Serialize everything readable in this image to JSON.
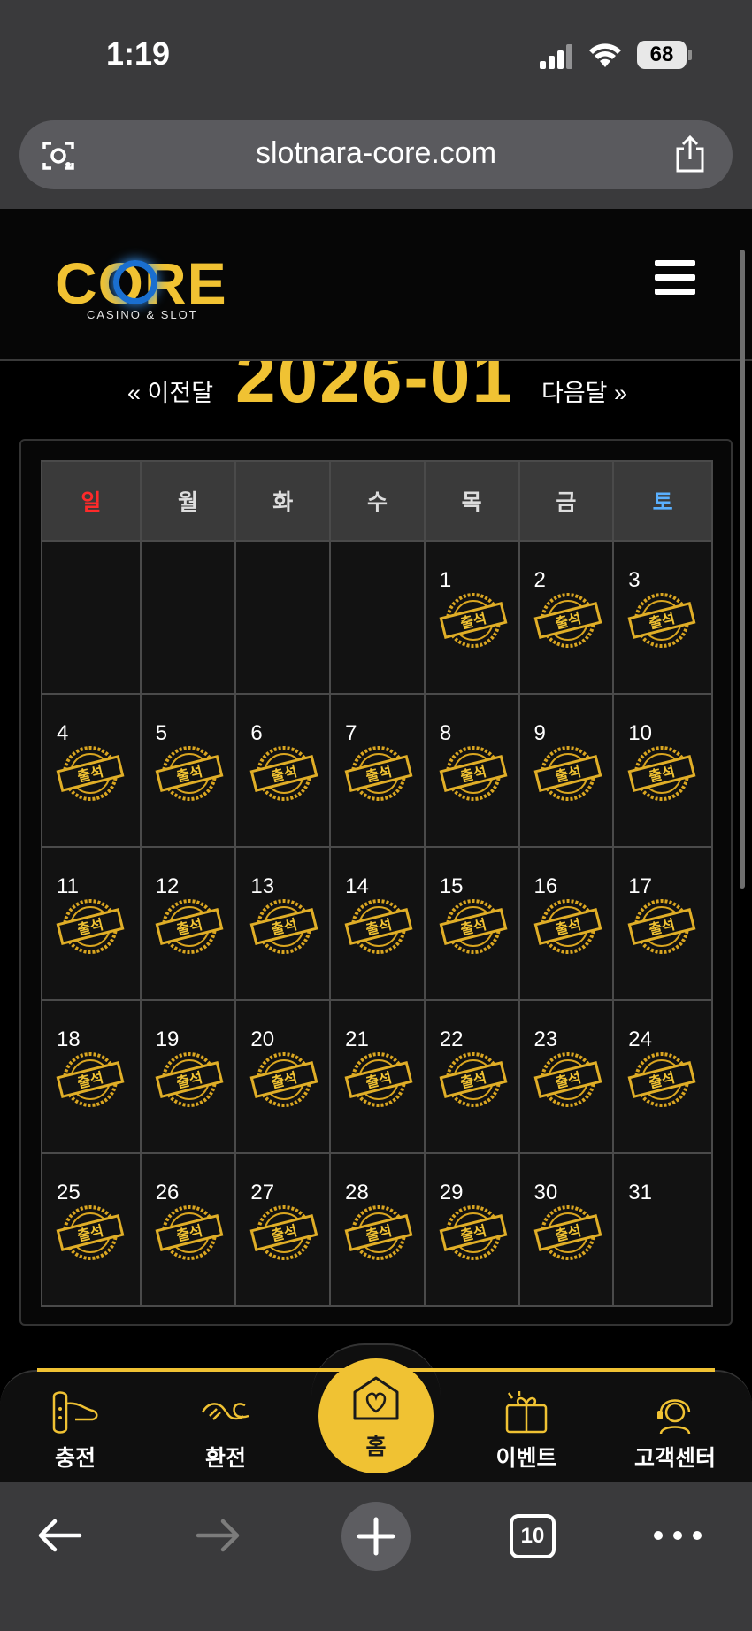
{
  "status_bar": {
    "time": "1:19",
    "battery": "68"
  },
  "browser": {
    "url": "slotnara-core.com",
    "tab_count": "10"
  },
  "site": {
    "logo_text": "CORE",
    "logo_subtitle": "CASINO & SLOT"
  },
  "calendar": {
    "prev_label": "« 이전달",
    "next_label": "다음달 »",
    "month_title": "2026-01",
    "weekdays": [
      "일",
      "월",
      "화",
      "수",
      "목",
      "금",
      "토"
    ],
    "stamp_label": "출석",
    "weeks": [
      [
        null,
        null,
        null,
        null,
        {
          "day": "1",
          "stamped": true
        },
        {
          "day": "2",
          "stamped": true
        },
        {
          "day": "3",
          "stamped": true
        }
      ],
      [
        {
          "day": "4",
          "stamped": true
        },
        {
          "day": "5",
          "stamped": true
        },
        {
          "day": "6",
          "stamped": true
        },
        {
          "day": "7",
          "stamped": true
        },
        {
          "day": "8",
          "stamped": true
        },
        {
          "day": "9",
          "stamped": true
        },
        {
          "day": "10",
          "stamped": true
        }
      ],
      [
        {
          "day": "11",
          "stamped": true
        },
        {
          "day": "12",
          "stamped": true
        },
        {
          "day": "13",
          "stamped": true
        },
        {
          "day": "14",
          "stamped": true
        },
        {
          "day": "15",
          "stamped": true
        },
        {
          "day": "16",
          "stamped": true
        },
        {
          "day": "17",
          "stamped": true
        }
      ],
      [
        {
          "day": "18",
          "stamped": true
        },
        {
          "day": "19",
          "stamped": true
        },
        {
          "day": "20",
          "stamped": true
        },
        {
          "day": "21",
          "stamped": true
        },
        {
          "day": "22",
          "stamped": true
        },
        {
          "day": "23",
          "stamped": true
        },
        {
          "day": "24",
          "stamped": true
        }
      ],
      [
        {
          "day": "25",
          "stamped": true
        },
        {
          "day": "26",
          "stamped": true
        },
        {
          "day": "27",
          "stamped": true
        },
        {
          "day": "28",
          "stamped": true
        },
        {
          "day": "29",
          "stamped": true
        },
        {
          "day": "30",
          "stamped": true
        },
        {
          "day": "31",
          "stamped": false
        }
      ]
    ]
  },
  "bottom_nav": {
    "deposit": "충전",
    "withdraw": "환전",
    "home": "홈",
    "event": "이벤트",
    "support": "고객센터"
  },
  "colors": {
    "gold": "#f0c233",
    "sunday": "#ff2a2a",
    "saturday": "#5ab0ff"
  }
}
